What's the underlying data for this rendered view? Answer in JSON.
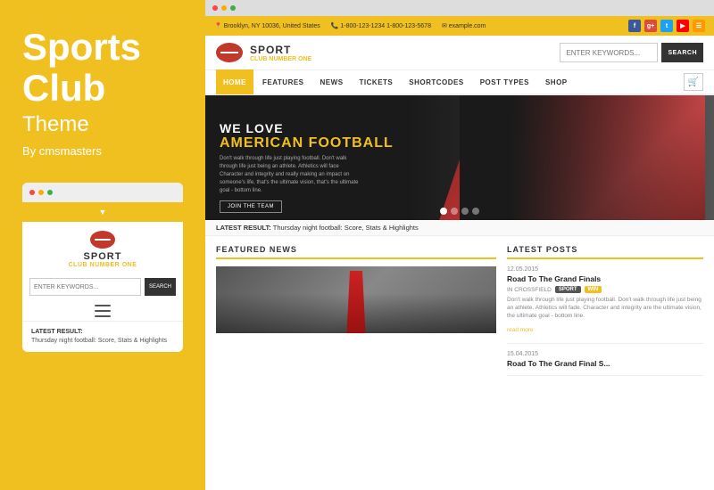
{
  "left": {
    "title_line1": "Sports",
    "title_line2": "Club",
    "subtitle": "Theme",
    "by": "By cmsmasters"
  },
  "mobile": {
    "logo_text": "SPORT",
    "logo_sub": "CLUB NUMBER",
    "logo_sub_highlight": "ONE",
    "search_placeholder": "ENTER KEYWORDS...",
    "search_btn": "SEARCH",
    "latest_label": "LATEST RESULT:",
    "latest_text": "Thursday night football: Score, Stats & Highlights"
  },
  "site": {
    "infobar": {
      "location": "📍 Brooklyn, NY 10036, United States",
      "phone": "📞 1-800-123-1234  1-800-123-5678",
      "email": "✉ example.com"
    },
    "logo_text": "SPORT",
    "logo_sub": "CLUB NUMBER",
    "logo_sub_highlight": "ONE",
    "search_placeholder": "ENTER KEYWORDS...",
    "search_btn": "SEARCH",
    "nav": {
      "home": "HOME",
      "features": "FEATURES",
      "news": "NEWS",
      "tickets": "TICKETS",
      "shortcodes": "SHORTCODES",
      "post_types": "POST TYPES",
      "shop": "SHOP"
    },
    "hero": {
      "line1": "WE LOVE",
      "line2a": "AMERICAN ",
      "line2b": "FOOTBALL",
      "desc": "Don't walk through life just playing football. Don't walk through life just being an athlete. Athletics will face Character and integrity and really making an impact on someone's life, that's the ultimate vision, that's the ultimate goal - bottom line.",
      "btn": "JOIN THE TEAM"
    },
    "latest_bar": {
      "prefix": "LATEST RESULT:",
      "text": "Thursday night football: Score, Stats & Highlights"
    },
    "featured_news": {
      "title": "FEATURED NEWS"
    },
    "latest_posts": {
      "title": "LATEST POSTS",
      "items": [
        {
          "date": "12.05.2015",
          "title": "Road To The Grand Finals",
          "tag_label": "IN CROSSFIELD",
          "tag1": "SPORT",
          "tag2": "WIN",
          "excerpt": "Don't walk through life just playing football. Don't walk through life just being an athlete. Athletics will fade. Character and integrity are the ultimate vision, the ultimate goal - bottom line.",
          "read_more": "read more"
        },
        {
          "date": "15.04.2015",
          "title": "Road To The Grand Final S...",
          "tag_label": "",
          "tag1": "",
          "tag2": "",
          "excerpt": "",
          "read_more": ""
        }
      ]
    }
  }
}
